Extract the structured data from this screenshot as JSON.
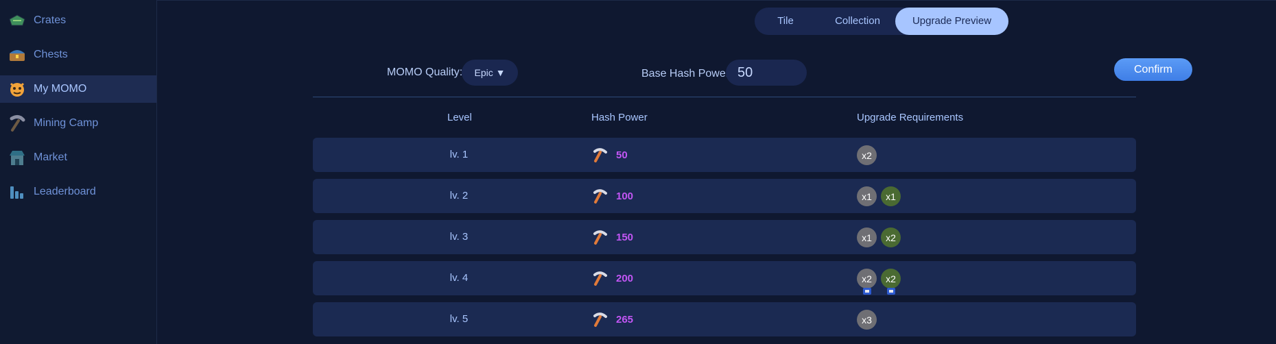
{
  "sidebar": {
    "items": [
      {
        "label": "Crates",
        "icon": "crate-icon"
      },
      {
        "label": "Chests",
        "icon": "chest-icon"
      },
      {
        "label": "My MOMO",
        "icon": "momo-icon",
        "active": true
      },
      {
        "label": "Mining Camp",
        "icon": "pickaxe-icon"
      },
      {
        "label": "Market",
        "icon": "market-icon"
      },
      {
        "label": "Leaderboard",
        "icon": "leaderboard-icon"
      }
    ]
  },
  "tabs": [
    {
      "label": "Tile"
    },
    {
      "label": "Collection"
    },
    {
      "label": "Upgrade Preview",
      "active": true
    }
  ],
  "filters": {
    "quality_label": "MOMO Quality:",
    "quality_value": "Epic ▼",
    "base_label": "Base Hash Power:",
    "base_value": "50",
    "confirm_label": "Confirm"
  },
  "table": {
    "headers": [
      "Level",
      "Hash Power",
      "Upgrade Requirements"
    ],
    "rows": [
      {
        "level": "lv. 1",
        "hash": "50",
        "reqs": [
          "x2"
        ]
      },
      {
        "level": "lv. 2",
        "hash": "100",
        "reqs": [
          "x1",
          "x1"
        ]
      },
      {
        "level": "lv. 3",
        "hash": "150",
        "reqs": [
          "x1",
          "x2"
        ]
      },
      {
        "level": "lv. 4",
        "hash": "200",
        "reqs": [
          "x2",
          "x2"
        ]
      },
      {
        "level": "lv. 5",
        "hash": "265",
        "reqs": [
          "x3"
        ]
      }
    ]
  },
  "colors": {
    "accent": "#a7c5ff",
    "hash_value": "#c356f5",
    "badge_grey": "#6f6f74",
    "badge_green": "#4a6a32"
  }
}
